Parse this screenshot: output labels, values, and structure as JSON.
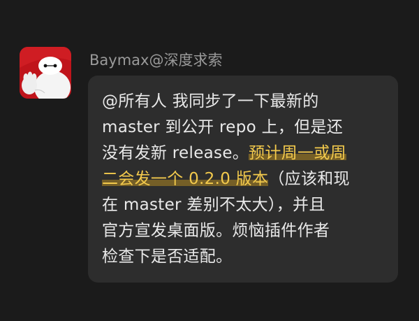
{
  "colors": {
    "background": "#1b1b1b",
    "bubble": "#2d2d2d",
    "sender_text": "#9a9a9a",
    "message_text": "#e9e9e9",
    "highlight_text": "#f2c94c",
    "avatar_red": "#c0141b"
  },
  "message": {
    "sender": "Baymax@深度求索",
    "avatar_icon": "baymax-avatar-icon",
    "lines": [
      {
        "segments": [
          {
            "text": "@所有人 我同步了一下最新的",
            "highlight": false
          }
        ]
      },
      {
        "segments": [
          {
            "text": "master 到公开 repo 上，但是还",
            "highlight": false
          }
        ]
      },
      {
        "segments": [
          {
            "text": "没有发新 release。",
            "highlight": false
          },
          {
            "text": "预计周一或周",
            "highlight": true
          }
        ]
      },
      {
        "segments": [
          {
            "text": "二会发一个 0.2.0 版本",
            "highlight": true
          },
          {
            "text": "（应该和现",
            "highlight": false
          }
        ]
      },
      {
        "segments": [
          {
            "text": "在 master 差别不太大），并且",
            "highlight": false
          }
        ]
      },
      {
        "segments": [
          {
            "text": "官方宣发桌面版。烦恼插件作者",
            "highlight": false
          }
        ]
      },
      {
        "segments": [
          {
            "text": "检查下是否适配。",
            "highlight": false
          }
        ]
      }
    ]
  }
}
